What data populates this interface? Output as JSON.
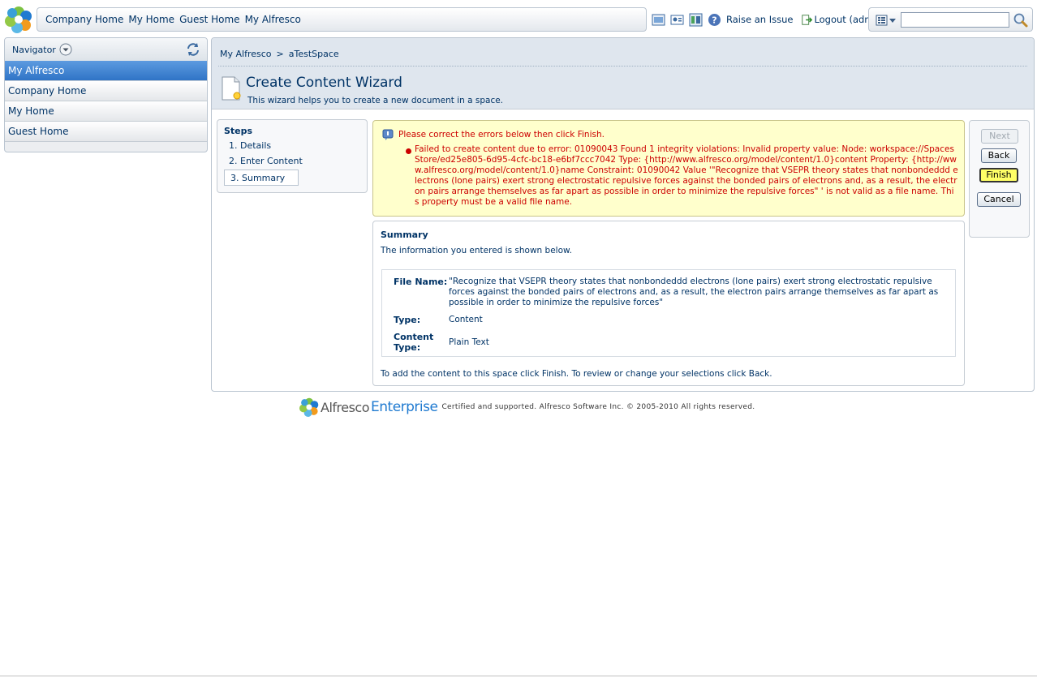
{
  "top": {
    "links": [
      "Company Home",
      "My Home",
      "Guest Home",
      "My Alfresco"
    ],
    "raise_issue": "Raise an Issue",
    "logout": "Logout (admin)",
    "search_value": ""
  },
  "navigator": {
    "title": "Navigator",
    "items": [
      {
        "label": "My Alfresco",
        "active": true
      },
      {
        "label": "Company Home"
      },
      {
        "label": "My Home"
      },
      {
        "label": "Guest Home"
      }
    ]
  },
  "breadcrumb": {
    "root": "My Alfresco",
    "separator": ">",
    "current": "aTestSpace"
  },
  "wizard": {
    "title": "Create Content Wizard",
    "description": "This wizard helps you to create a new document in a space."
  },
  "steps": {
    "title": "Steps",
    "items": [
      "1. Details",
      "2. Enter Content",
      "3. Summary"
    ]
  },
  "error": {
    "heading": "Please correct the errors below then click Finish.",
    "message": "Failed to create content due to error: 01090043 Found 1 integrity violations: Invalid property value: Node: workspace://SpacesStore/ed25e805-6d95-4cfc-bc18-e6bf7ccc7042 Type: {http://www.alfresco.org/model/content/1.0}content Property: {http://www.alfresco.org/model/content/1.0}name Constraint: 01090042 Value '\"Recognize that VSEPR theory states that nonbondeddd electrons (lone pairs) exert strong electrostatic repulsive forces against the bonded pairs of electrons and, as a result, the electron pairs arrange themselves as far apart as possible in order to minimize the repulsive forces\" ' is not valid as a file name. This property must be a valid file name."
  },
  "summary": {
    "title": "Summary",
    "intro": "The information you entered is shown below.",
    "file_name_label": "File Name:",
    "file_name_value": "\"Recognize that VSEPR theory states that nonbondeddd electrons (lone pairs) exert strong electrostatic repulsive forces against the bonded pairs of electrons and, as a result, the electron pairs arrange themselves as far apart as possible in order to minimize the repulsive forces\"",
    "type_label": "Type:",
    "type_value": "Content",
    "content_type_label": "Content Type:",
    "content_type_value": "Plain Text",
    "footer": "To add the content to this space click Finish. To review or change your selections click Back."
  },
  "buttons": {
    "next": "Next",
    "back": "Back",
    "finish": "Finish",
    "cancel": "Cancel"
  },
  "footer": {
    "brand_a": "Alfresco",
    "brand_b": "Enterprise",
    "text": "Certified and supported. Alfresco Software Inc. © 2005-2010 All rights reserved."
  },
  "colors": {
    "link": "#003366",
    "error": "#cc0000",
    "active_nav": "#2f74c6",
    "brand": "#1f7ad0"
  }
}
